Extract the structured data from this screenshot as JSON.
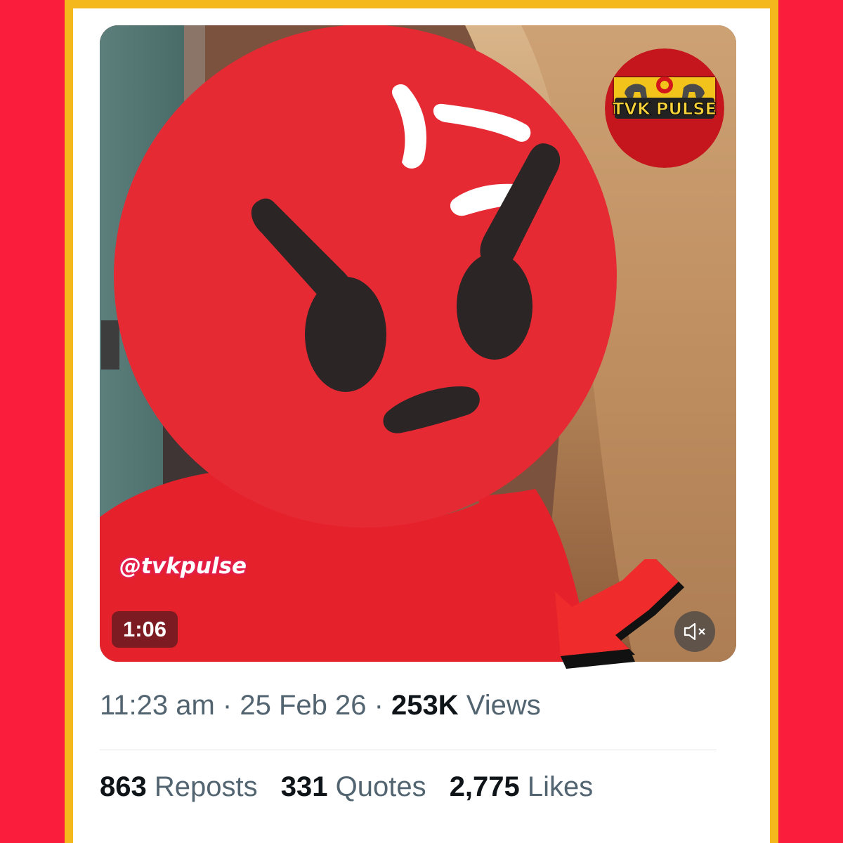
{
  "colors": {
    "background": "#fb1d3c",
    "frame": "#f4b81c",
    "emoji_face": "#e62a34",
    "arrow": "#ef2b2b",
    "duration_badge": "#7c1b21"
  },
  "video": {
    "watermark_handle": "@tvkpulse",
    "duration": "1:06",
    "mute_icon": "speaker-muted-icon",
    "overlay_emoji": "angry-face-emoji"
  },
  "logo": {
    "text": "TVK PULSE"
  },
  "post_meta": {
    "time": "11:23 am",
    "separator": " · ",
    "date": "25 Feb 26",
    "views_count": "253K",
    "views_label": " Views"
  },
  "stats": {
    "reposts_count": "863",
    "reposts_label": " Reposts",
    "quotes_count": "331",
    "quotes_label": " Quotes",
    "likes_count": "2,775",
    "likes_label": " Likes"
  },
  "annotation": {
    "arrow_icon": "red-arrow-pointer-icon"
  }
}
